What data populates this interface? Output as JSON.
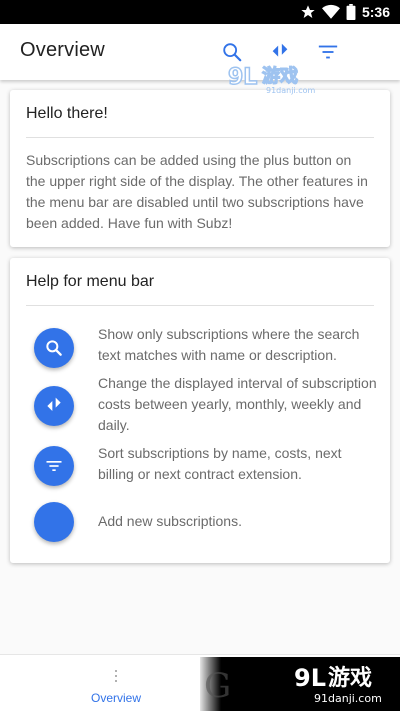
{
  "status_bar": {
    "time": "5:36"
  },
  "app_bar": {
    "title": "Overview",
    "actions": [
      "search-icon",
      "interval-icon",
      "sort-icon"
    ]
  },
  "watermark": {
    "brand": "9L游戏",
    "site": "91danji.com"
  },
  "cards": {
    "hello": {
      "title": "Hello there!",
      "body": "Subscriptions can be added using the plus button on the upper right side of the display. The other features in the menu bar are disabled until two subscriptions have been added. Have fun with Subz!"
    },
    "help": {
      "title": "Help for menu bar",
      "items": [
        {
          "icon": "search-icon",
          "text": "Show only subscriptions where the search text matches with name or description."
        },
        {
          "icon": "interval-icon",
          "text": "Change the displayed interval of subscription costs between yearly, monthly, weekly and daily."
        },
        {
          "icon": "sort-icon",
          "text": "Sort subscriptions by name, costs, next billing or next contract extension."
        },
        {
          "icon": "add-icon",
          "text": "Add new subscriptions."
        }
      ]
    }
  },
  "bottom_nav": {
    "items": [
      {
        "label": "Overview",
        "icon": "more-vert-icon"
      }
    ]
  },
  "colors": {
    "accent": "#3273e8",
    "text_secondary": "#6b6b6b",
    "status_bar": "#000000"
  }
}
